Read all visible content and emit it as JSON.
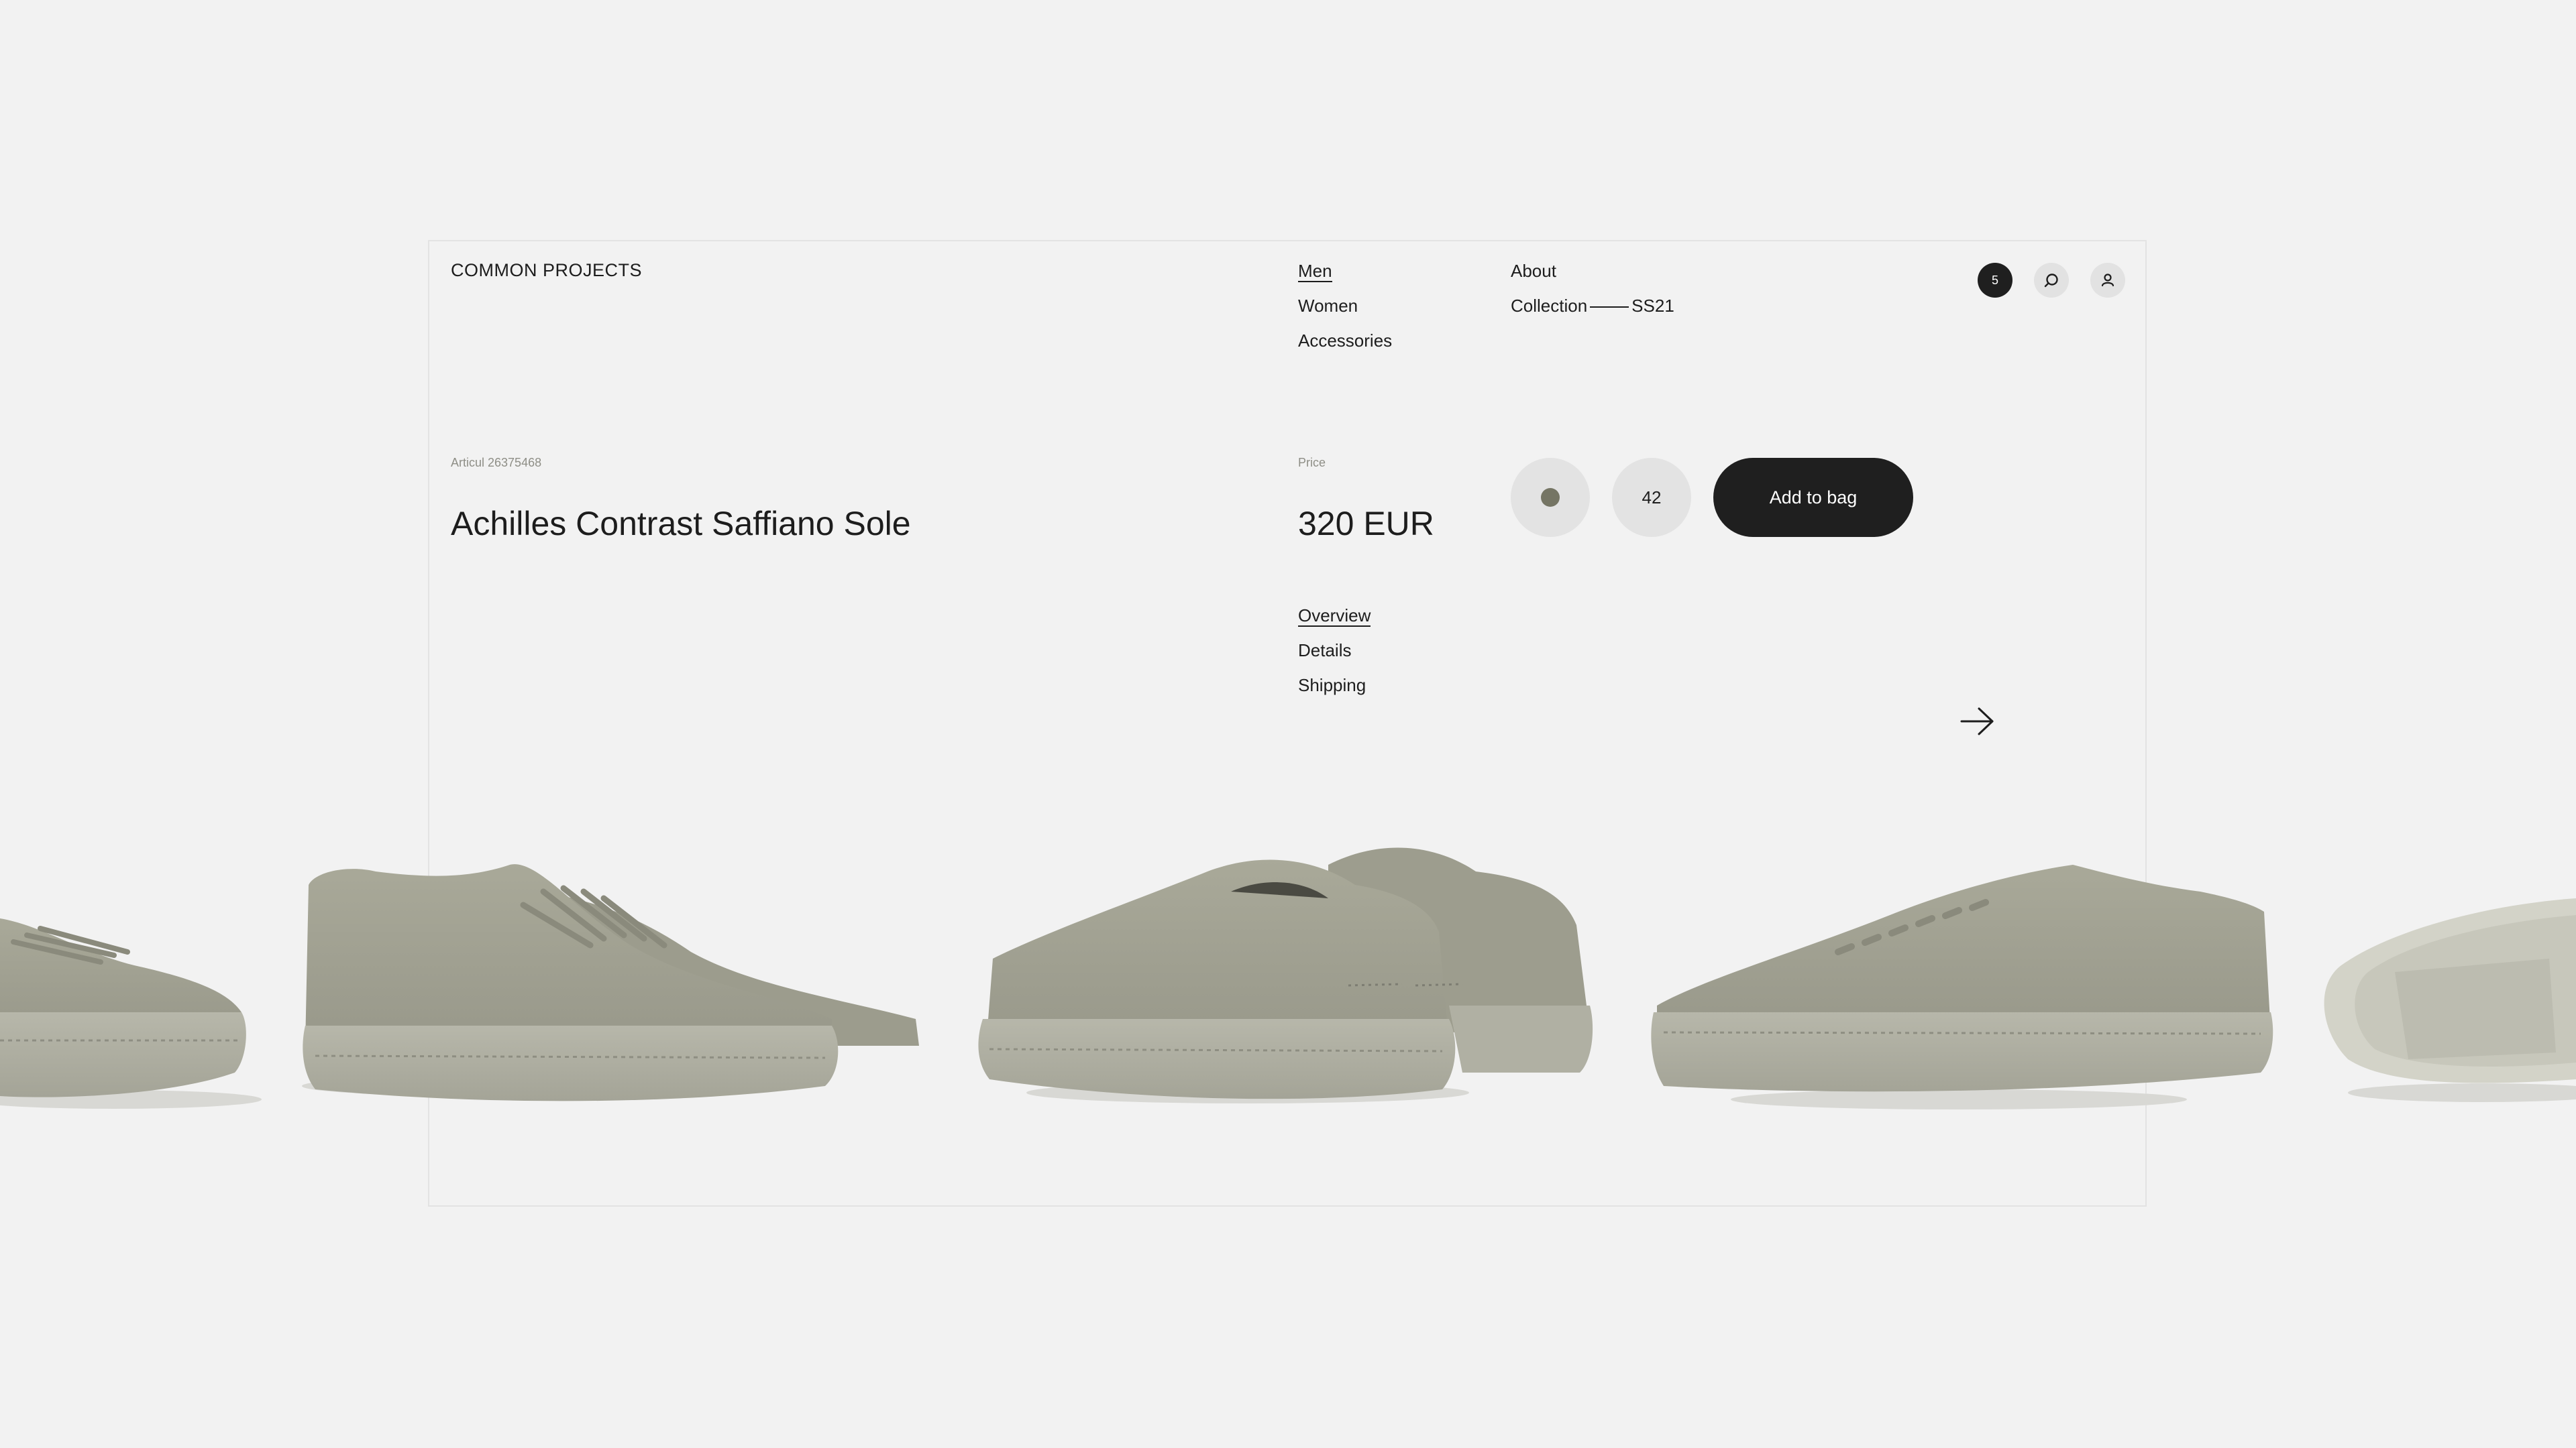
{
  "header": {
    "brand": "COMMON PROJECTS",
    "nav_primary": [
      {
        "label": "Men",
        "active": true
      },
      {
        "label": "Women",
        "active": false
      },
      {
        "label": "Accessories",
        "active": false
      }
    ],
    "nav_secondary": {
      "about": "About",
      "collection": "Collection",
      "collection_season": "SS21"
    },
    "bag_count": "5",
    "icons": [
      "bag-count-badge",
      "search-icon",
      "user-icon"
    ]
  },
  "product": {
    "articul": "Articul 26375468",
    "title": "Achilles Contrast Saffiano Sole",
    "price_label": "Price",
    "price": "320 EUR",
    "color_swatch": "#757564",
    "size": "42",
    "add_to_bag": "Add to bag"
  },
  "tabs": [
    {
      "label": "Overview",
      "active": true
    },
    {
      "label": "Details",
      "active": false
    },
    {
      "label": "Shipping",
      "active": false
    }
  ],
  "gallery": {
    "next_icon": "arrow-right-icon",
    "shoe_color": "#a3a393"
  }
}
